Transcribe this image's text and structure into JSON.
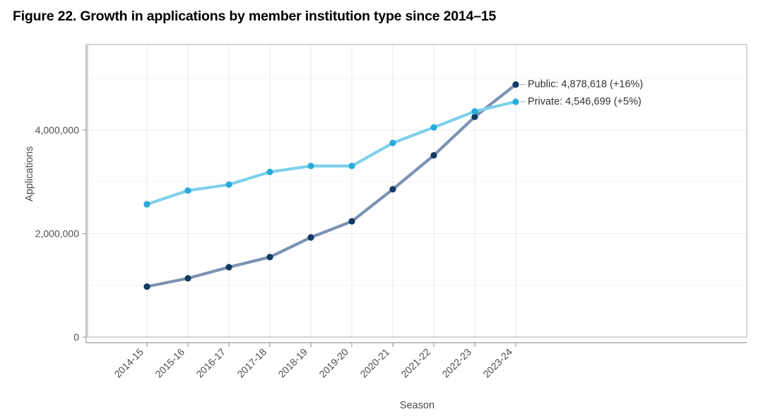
{
  "figure": {
    "title": "Figure 22. Growth in applications by member institution type since 2014–15"
  },
  "axes": {
    "x_title": "Season",
    "y_title": "Applications",
    "y_ticks": [
      "0",
      "2,000,000",
      "4,000,000"
    ],
    "x_ticks": [
      "2014-15",
      "2015-16",
      "2016-17",
      "2017-18",
      "2018-19",
      "2019-20",
      "2020-21",
      "2021-22",
      "2022-23",
      "2023-24"
    ]
  },
  "labels": {
    "public": "Public: 4,878,618 (+16%)",
    "private": "Private: 4,546,699 (+5%)"
  },
  "colors": {
    "public_line": "#7b92b3",
    "public_point": "#123a62",
    "private_line": "#7ed0ec",
    "private_point": "#29abd9",
    "panel_border": "#b3b3b3",
    "gridline": "#ececec",
    "axis_text": "#4d4d4d"
  },
  "chart_data": {
    "type": "line",
    "title": "Figure 22. Growth in applications by member institution type since 2014–15",
    "xlabel": "Season",
    "ylabel": "Applications",
    "categories": [
      "2014-15",
      "2015-16",
      "2016-17",
      "2017-18",
      "2018-19",
      "2019-20",
      "2020-21",
      "2021-22",
      "2022-23",
      "2023-24"
    ],
    "series": [
      {
        "name": "Public",
        "color": "#123a62",
        "end_label": "Public: 4,878,618 (+16%)",
        "end_value": 4878618,
        "values": [
          975000,
          1135000,
          1350000,
          1545000,
          1925000,
          2235000,
          2855000,
          3510000,
          4255000,
          4878618
        ]
      },
      {
        "name": "Private",
        "color": "#29abd9",
        "end_label": "Private: 4,546,699 (+5%)",
        "end_value": 4546699,
        "values": [
          2565000,
          2830000,
          2945000,
          3190000,
          3305000,
          3305000,
          3750000,
          4050000,
          4360000,
          4546699
        ]
      }
    ],
    "ylim": [
      0,
      5350000
    ],
    "ytick_values": [
      0,
      2000000,
      4000000
    ],
    "minor_ytick_values": [
      1000000,
      3000000,
      5000000
    ],
    "grid": true,
    "legend": "inline-end-labels"
  }
}
